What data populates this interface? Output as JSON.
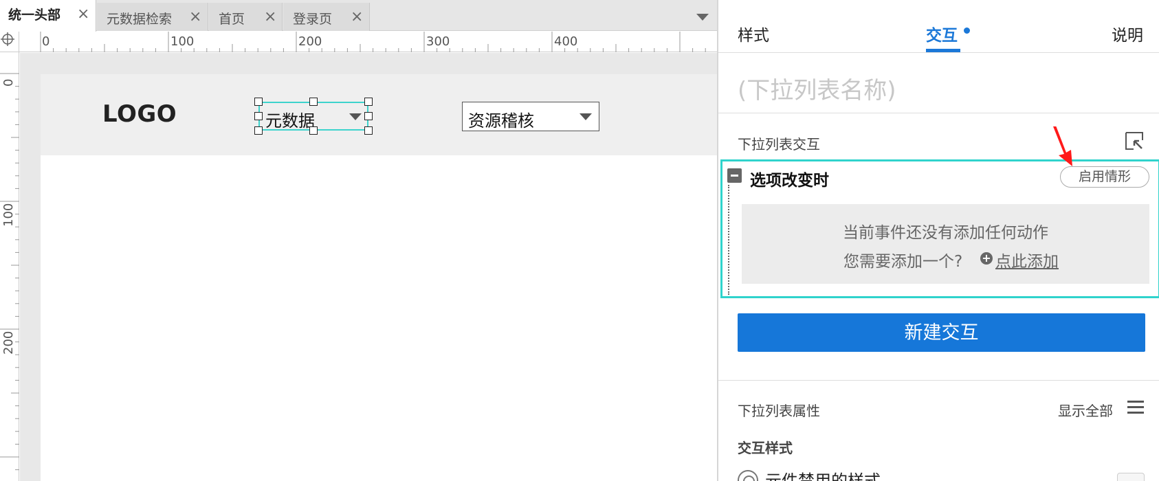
{
  "editor": {
    "tabs": [
      {
        "label": "统一头部",
        "active": true
      },
      {
        "label": "元数据检索",
        "active": false
      },
      {
        "label": "首页",
        "active": false
      },
      {
        "label": "登录页",
        "active": false
      }
    ],
    "close_glyph": "×",
    "ruler_h_labels": [
      "0",
      "100",
      "200",
      "300",
      "400"
    ],
    "ruler_v_labels": [
      "0",
      "100",
      "200"
    ],
    "canvas": {
      "logo_text": "LOGO",
      "dropdown1_text": "元数据",
      "dropdown2_text": "资源稽核"
    }
  },
  "inspector": {
    "tabs": {
      "style": "样式",
      "interaction": "交互",
      "notes": "说明"
    },
    "widget_name_placeholder": "(下拉列表名称)",
    "section_title": "下拉列表交互",
    "event": {
      "title": "选项改变时",
      "enable_case_button": "启用情形",
      "empty_line1": "当前事件还没有添加任何动作",
      "empty_line2": "您需要添加一个?",
      "add_link": "点此添加"
    },
    "new_interaction_button": "新建交互",
    "props_title": "下拉列表属性",
    "show_all": "显示全部",
    "interaction_styles_title": "交互样式",
    "disabled_style_label": "元件禁用的样式"
  },
  "colors": {
    "accent": "#1b78d8",
    "selection": "#2fd3cc",
    "annotation_arrow": "#ff1a1a"
  },
  "icons": [
    "crosshair-icon",
    "close-icon",
    "chevron-down-icon",
    "collapse-panel-icon",
    "minus-icon",
    "plus-circle-icon",
    "hamburger-menu-icon",
    "radio-target-icon"
  ]
}
